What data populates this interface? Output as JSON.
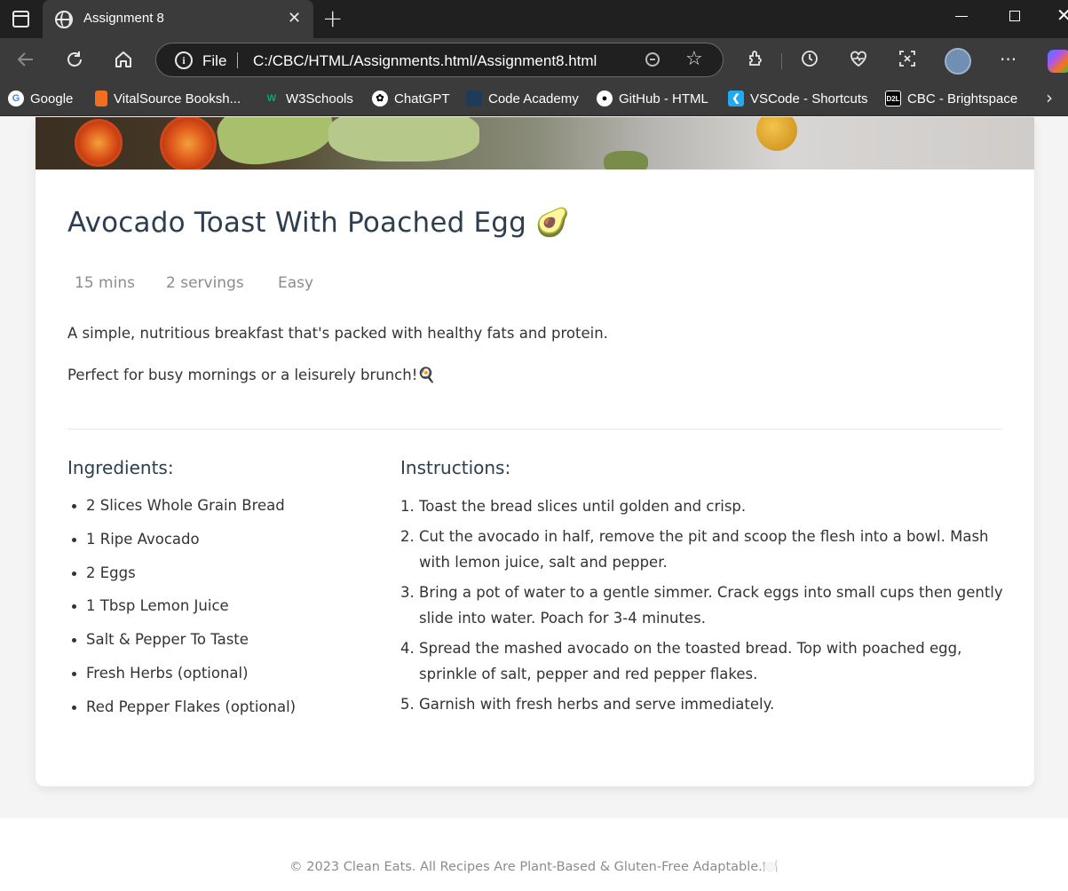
{
  "browser": {
    "tab_title": "Assignment 8",
    "tab_close": "✕",
    "new_tab": "+",
    "address_scheme_label": "File",
    "address_url": "C:/CBC/HTML/Assignments.html/Assignment8.html",
    "bookmarks": [
      {
        "label": "Google",
        "icon": "google-icon",
        "color": "#4285F4"
      },
      {
        "label": "VitalSource Booksh...",
        "icon": "vitalsource-icon",
        "color": "#F26F21"
      },
      {
        "label": "W3Schools",
        "icon": "w3schools-icon",
        "color": "#04AA6D"
      },
      {
        "label": "ChatGPT",
        "icon": "chatgpt-icon",
        "color": "#ffffff"
      },
      {
        "label": "Code Academy",
        "icon": "codeacademy-icon",
        "color": "#1f3b5a"
      },
      {
        "label": "GitHub - HTML",
        "icon": "github-icon",
        "color": "#ffffff"
      },
      {
        "label": "VSCode - Shortcuts",
        "icon": "vscode-icon",
        "color": "#23A9F2"
      },
      {
        "label": "CBC - Brightspace",
        "icon": "d2l-icon",
        "color": "#000000"
      }
    ]
  },
  "recipe": {
    "title": "Avocado Toast With Poached Egg",
    "title_emoji": "🥑",
    "time": "15 mins",
    "servings": "2 servings",
    "difficulty": "Easy",
    "description_1": "A simple, nutritious breakfast that's packed with healthy fats and protein.",
    "description_2": "Perfect for busy mornings or a leisurely brunch!",
    "description_2_emoji": "🍳",
    "ingredients_heading": "Ingredients:",
    "instructions_heading": "Instructions:",
    "ingredients": [
      "2 Slices Whole Grain Bread",
      "1 Ripe Avocado",
      "2 Eggs",
      "1 Tbsp Lemon Juice",
      "Salt & Pepper To Taste",
      "Fresh Herbs (optional)",
      "Red Pepper Flakes (optional)"
    ],
    "instructions": [
      "Toast the bread slices until golden and crisp.",
      "Cut the avocado in half, remove the pit and scoop the flesh into a bowl. Mash with lemon juice, salt and pepper.",
      "Bring a pot of water to a gentle simmer. Crack eggs into small cups then gently slide into water. Poach for 3-4 minutes.",
      "Spread the mashed avocado on the toasted bread. Top with poached egg, sprinkle of salt, pepper and red pepper flakes.",
      "Garnish with fresh herbs and serve immediately."
    ]
  },
  "footer": {
    "text": "© 2023 Clean Eats. All Recipes Are Plant-Based & Gluten-Free Adaptable.",
    "emoji": "🍽️"
  },
  "colors": {
    "heading": "#2c3e50",
    "body_text": "#333333",
    "muted": "#8c8c8c",
    "page_bg": "#f4f4f4",
    "chrome_dark": "#202020",
    "chrome_toolbar": "#3b3b3b"
  }
}
